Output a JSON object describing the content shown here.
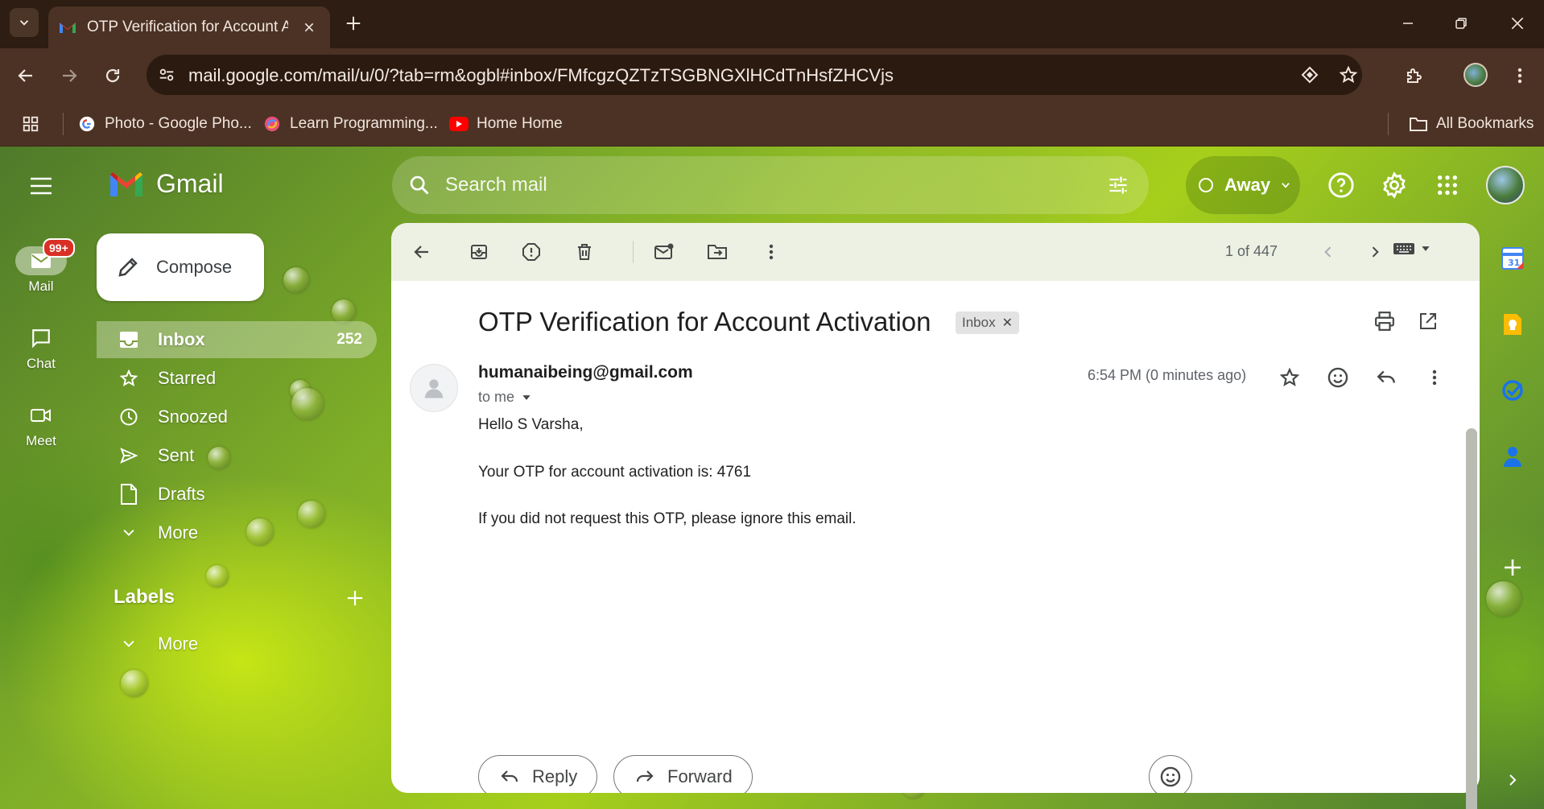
{
  "browser": {
    "tab_title": "OTP Verification for Account Activation",
    "url": "mail.google.com/mail/u/0/?tab=rm&ogbl#inbox/FMfcgzQZTzTSGBNGXlHCdTnHsfZHCVjs",
    "bookmarks": [
      {
        "label": "Photo - Google Pho..."
      },
      {
        "label": "Learn Programming..."
      },
      {
        "label": "Home Home"
      }
    ],
    "all_bookmarks": "All Bookmarks"
  },
  "rail": {
    "mail": {
      "label": "Mail",
      "badge": "99+"
    },
    "chat": {
      "label": "Chat"
    },
    "meet": {
      "label": "Meet"
    }
  },
  "header": {
    "brand": "Gmail",
    "search_placeholder": "Search mail",
    "status": "Away"
  },
  "sidebar": {
    "compose": "Compose",
    "items": [
      {
        "label": "Inbox",
        "count": "252"
      },
      {
        "label": "Starred"
      },
      {
        "label": "Snoozed"
      },
      {
        "label": "Sent"
      },
      {
        "label": "Drafts"
      },
      {
        "label": "More"
      }
    ],
    "labels_title": "Labels",
    "labels_more": "More"
  },
  "email": {
    "pager": "1 of 447",
    "subject": "OTP Verification for Account Activation",
    "label_chip": "Inbox",
    "sender": "humanaibeing@gmail.com",
    "recipient": "to me",
    "time": "6:54 PM (0 minutes ago)",
    "body": [
      "Hello S Varsha,",
      "Your OTP for account activation is: 4761",
      "If you did not request this OTP, please ignore this email."
    ],
    "reply": "Reply",
    "forward": "Forward"
  },
  "colors": {
    "accent_red": "#d93025",
    "chrome_bg": "#4b3224"
  }
}
